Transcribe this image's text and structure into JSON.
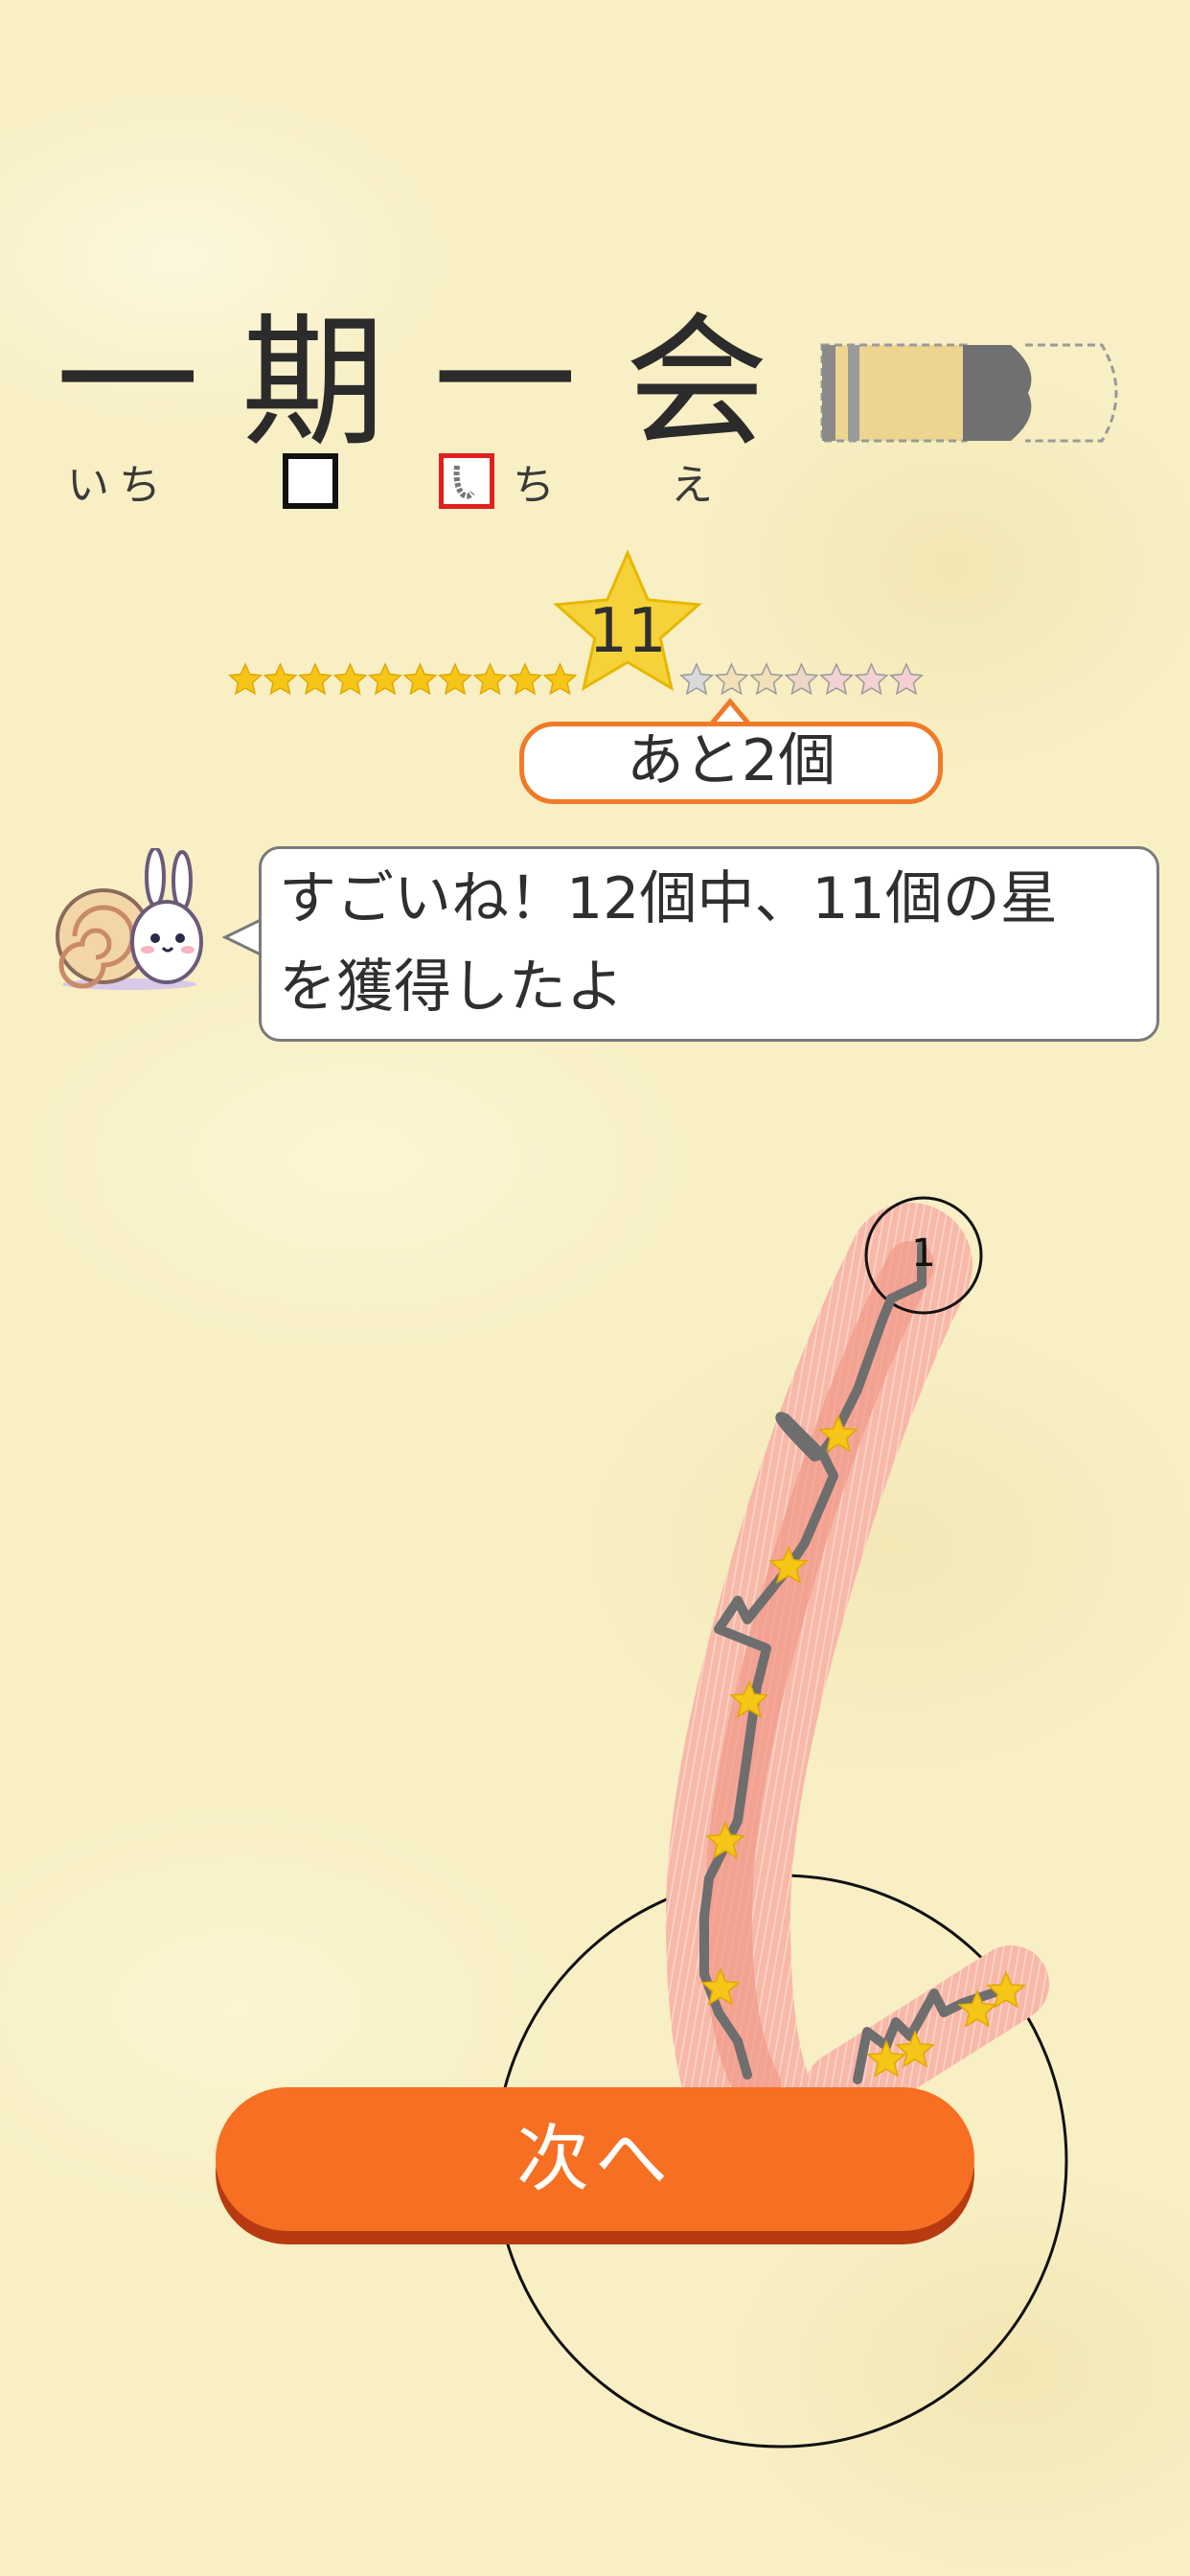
{
  "word": {
    "kanji": [
      "一",
      "期",
      "一",
      "会"
    ],
    "readings": [
      "いち",
      "",
      "ち",
      "え"
    ]
  },
  "progress": {
    "stars_earned": 11,
    "stars_total": 12,
    "earned_label": "11",
    "remaining_label": "あと2個"
  },
  "message": {
    "line1": "すごいね！12個中、11個の星",
    "line2": "を獲得したよ"
  },
  "stroke": {
    "start_number": "1"
  },
  "next_button": {
    "label": "次へ"
  },
  "colors": {
    "accent": "#f76f22",
    "accent_shadow": "#b73a10",
    "star": "#f5c518",
    "red_box": "#e02020",
    "stroke_band": "#f4a090"
  },
  "icons": [
    "pencil-icon",
    "star-icon",
    "snail-bunny-mascot-icon"
  ]
}
